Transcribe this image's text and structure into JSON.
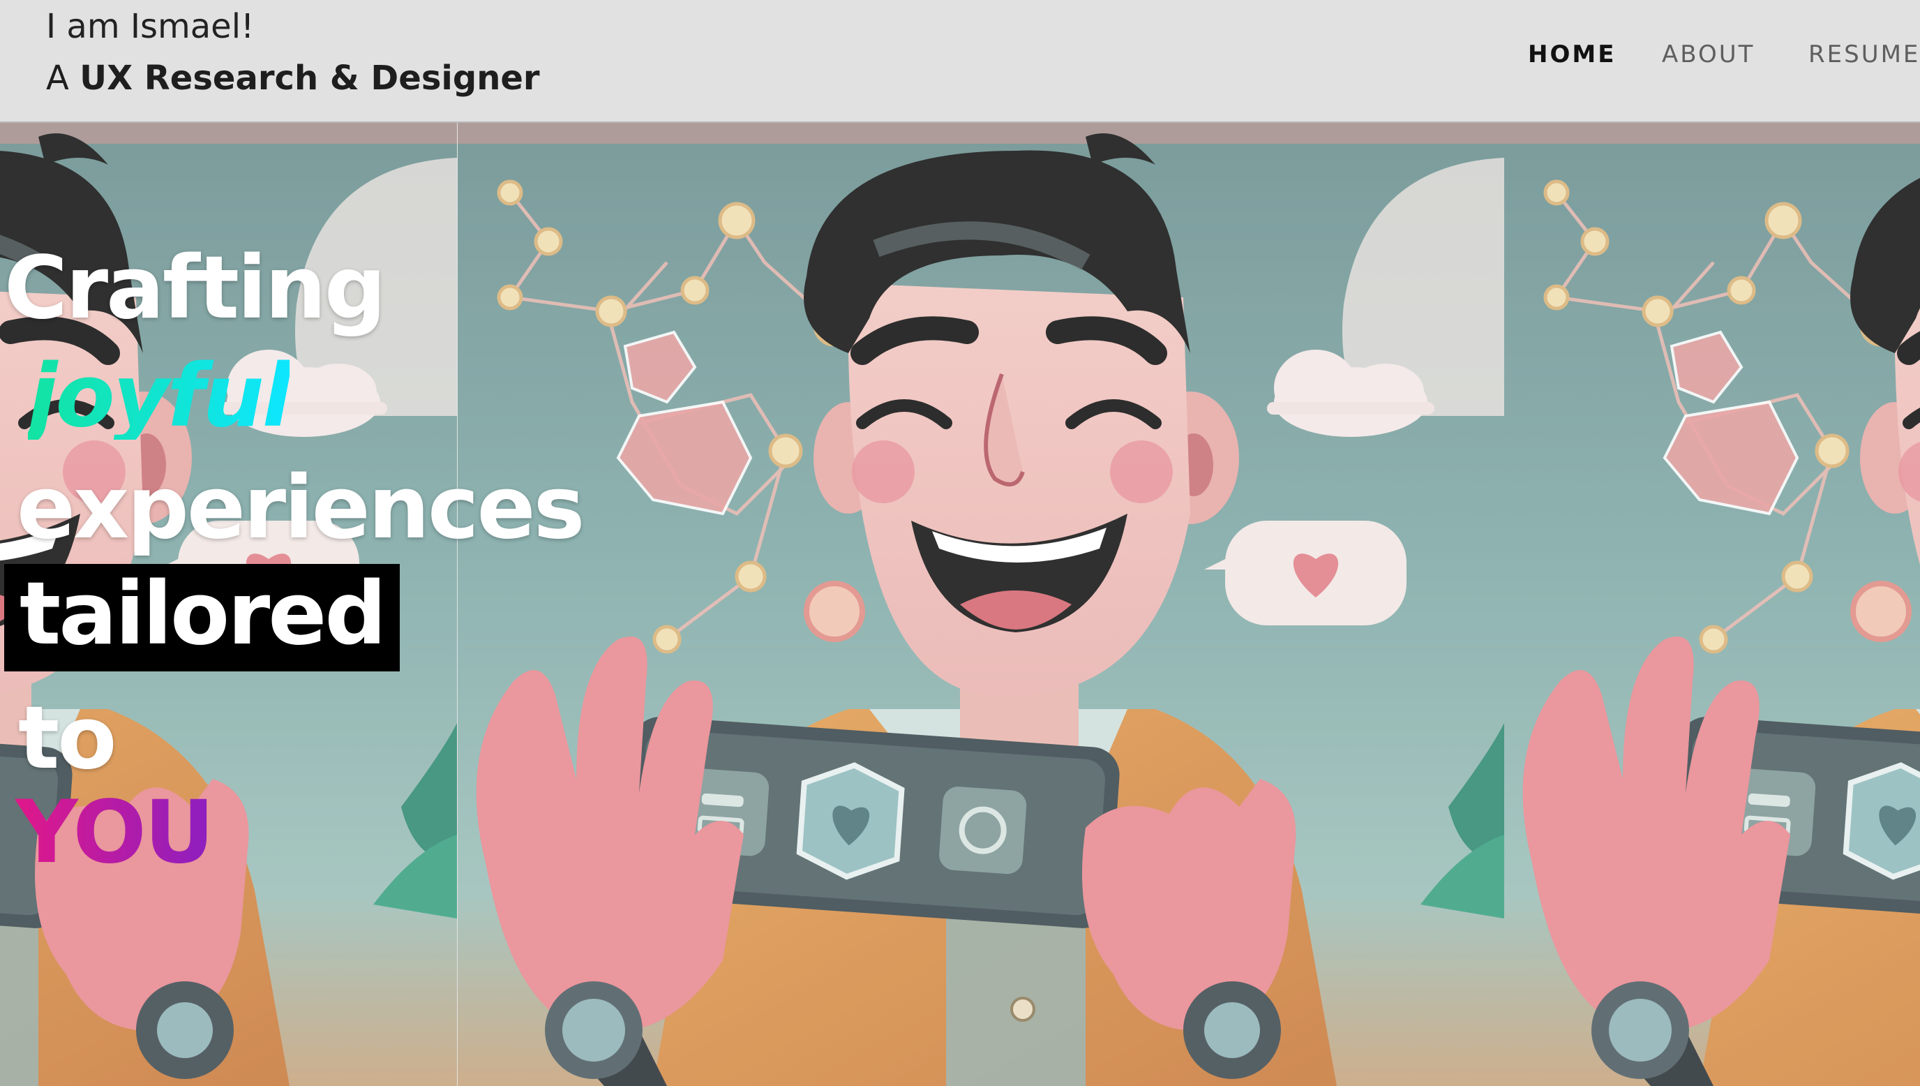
{
  "header": {
    "greeting": "I am Ismael!",
    "role_prefix": "A",
    "role": "UX Research & Designer"
  },
  "nav": {
    "items": [
      {
        "label": "HOME",
        "active": true
      },
      {
        "label": "ABOUT",
        "active": false
      },
      {
        "label": "RESUME",
        "active": false
      }
    ]
  },
  "hero": {
    "headline": {
      "line1": "Crafting",
      "line2": "joyful",
      "line3": "experiences",
      "line4": "tailored",
      "line5": "to",
      "line6": "YOU"
    },
    "illustration": "smiling-cartoon-man-holding-phone",
    "colors": {
      "joyful_gradient": [
        "#13e3a1",
        "#0ee6ff"
      ],
      "you_gradient": [
        "#e0188a",
        "#8c1fc0"
      ]
    }
  }
}
